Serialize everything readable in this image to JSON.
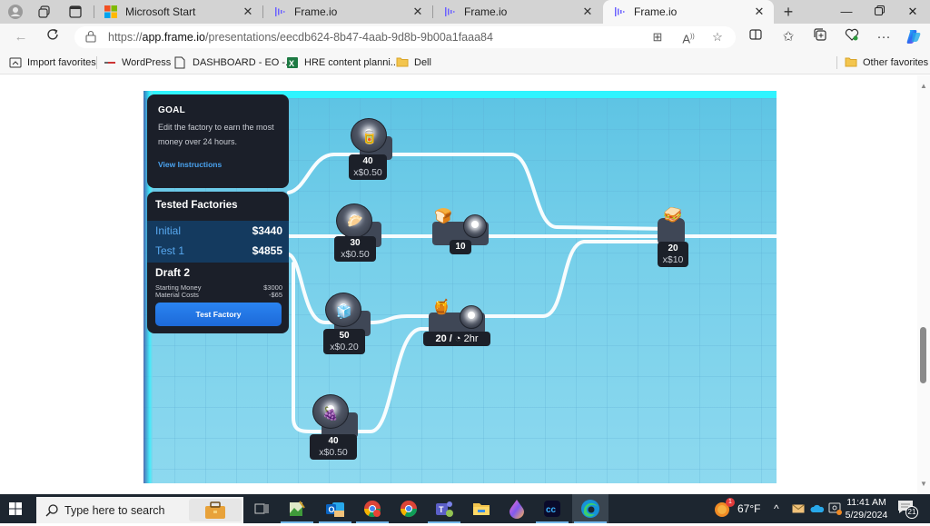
{
  "browser": {
    "tabs": [
      {
        "title": "Microsoft Start",
        "favicon": "microsoft-logo-icon",
        "active": false
      },
      {
        "title": "Frame.io",
        "favicon": "frameio-logo-icon",
        "active": false
      },
      {
        "title": "Frame.io",
        "favicon": "frameio-logo-icon",
        "active": false
      },
      {
        "title": "Frame.io",
        "favicon": "frameio-logo-icon",
        "active": true
      }
    ],
    "url_prefix": "https://",
    "url_host": "app.frame.io",
    "url_path": "/presentations/eecdb624-8b47-4aab-9d8b-9b00a1faaa84",
    "favorites": [
      {
        "label": "Import favorites",
        "icon": "import-icon"
      },
      {
        "label": "WordPress",
        "icon": "wordpress-icon"
      },
      {
        "label": "DASHBOARD - EO -...",
        "icon": "document-icon"
      },
      {
        "label": "HRE content planni...",
        "icon": "excel-icon"
      },
      {
        "label": "Dell",
        "icon": "folder-icon"
      }
    ],
    "other_favorites": "Other favorites"
  },
  "game": {
    "goal": {
      "heading": "GOAL",
      "text": "Edit the factory to earn the most money over 24 hours.",
      "link": "View Instructions"
    },
    "tested": {
      "heading": "Tested Factories",
      "rows": [
        {
          "name": "Initial",
          "value": "$3440"
        },
        {
          "name": "Test 1",
          "value": "$4855"
        }
      ],
      "draft": {
        "name": "Draft 2",
        "starting_money_label": "Starting Money",
        "starting_money": "$3000",
        "material_costs_label": "Material Costs",
        "material_costs": "-$65"
      },
      "button": "Test Factory"
    },
    "machines": [
      {
        "id": "peanut-butter-source",
        "item": "peanut-butter",
        "qty": "40",
        "cost": "x$0.50"
      },
      {
        "id": "bread-dough-source",
        "item": "bread-dough",
        "qty": "30",
        "cost": "x$0.50"
      },
      {
        "id": "bread-oven",
        "item": "bread-slices",
        "qty": "10"
      },
      {
        "id": "sugar-source",
        "item": "sugar-cubes",
        "qty": "50",
        "cost": "x$0.20"
      },
      {
        "id": "jam-maker",
        "item": "jam-jar",
        "qty": "20",
        "sep": "/",
        "time": "2hr"
      },
      {
        "id": "berry-source",
        "item": "raspberries",
        "qty": "40",
        "cost": "x$0.50"
      },
      {
        "id": "sandwich-output",
        "item": "sandwich",
        "qty": "20",
        "cost": "x$10"
      }
    ]
  },
  "taskbar": {
    "search_placeholder": "Type here to search",
    "weather": "67°F",
    "time": "11:41 AM",
    "date": "5/29/2024",
    "notifications": "21",
    "weather_badge": "1"
  }
}
